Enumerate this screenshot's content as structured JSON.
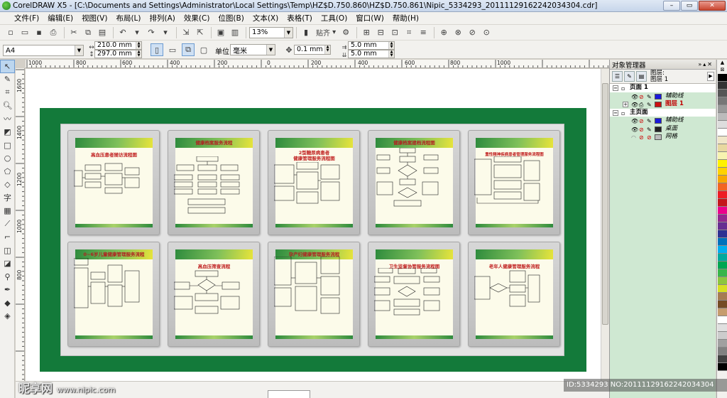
{
  "window": {
    "title": "CorelDRAW X5 - [C:\\Documents and Settings\\Administrator\\Local Settings\\Temp\\HZ$D.750.860\\HZ$D.750.861\\Nipic_5334293_20111129162242034304.cdr]",
    "min": "–",
    "max": "▭",
    "close": "✕"
  },
  "menu": [
    "文件(F)",
    "编辑(E)",
    "视图(V)",
    "布局(L)",
    "排列(A)",
    "效果(C)",
    "位图(B)",
    "文本(X)",
    "表格(T)",
    "工具(O)",
    "窗口(W)",
    "帮助(H)"
  ],
  "toolbar": {
    "zoom": "13%",
    "snap": "贴齐"
  },
  "property_bar": {
    "paper": "A4",
    "width": "210.0 mm",
    "height": "297.0 mm",
    "units_label": "单位:",
    "units": "毫米",
    "nudge": "0.1 mm",
    "dup_x": "5.0 mm",
    "dup_y": "5.0 mm"
  },
  "rulers": {
    "h": [
      "1000",
      "800",
      "600",
      "400",
      "200",
      "0",
      "200",
      "400",
      "600",
      "800",
      "1000"
    ],
    "v": [
      "1600",
      "1400",
      "1200",
      "1000",
      "800"
    ]
  },
  "panels": [
    {
      "title": "高血压患者随访流程图",
      "title_on_band": false
    },
    {
      "title": "健康档案服务流程",
      "title_on_band": true
    },
    {
      "title": "2型糖尿病患者\n健康管理服务流程图",
      "title_on_band": false
    },
    {
      "title": "健康档案建档流程图",
      "title_on_band": true
    },
    {
      "title": "重性精神疾病患者管理服务流程图",
      "title_on_band": false
    },
    {
      "title": "0~6岁儿童健康管理服务流程",
      "title_on_band": true
    },
    {
      "title": "高血压筛查流程",
      "title_on_band": false
    },
    {
      "title": "孕产妇健康管理服务流程",
      "title_on_band": true
    },
    {
      "title": "卫生监督协管服务流程图",
      "title_on_band": false
    },
    {
      "title": "老年人健康管理服务流程",
      "title_on_band": false
    }
  ],
  "docker": {
    "title": "对象管理器",
    "layer_header": "图层:",
    "layer_current": "图层 1",
    "tree": [
      {
        "type": "page",
        "label": "页面 1",
        "indent": 0
      },
      {
        "type": "layer",
        "label": "辅助线",
        "indent": 1,
        "color": "#1a1adc"
      },
      {
        "type": "layer1",
        "label": "图层 1",
        "indent": 1,
        "color": "#cc1111"
      },
      {
        "type": "page",
        "label": "主页面",
        "indent": 0
      },
      {
        "type": "layer",
        "label": "辅助线",
        "indent": 1,
        "color": "#1a1adc"
      },
      {
        "type": "layer",
        "label": "桌面",
        "indent": 1,
        "color": "#222222"
      },
      {
        "type": "layer",
        "label": "网格",
        "indent": 1,
        "color": "#bbbbbb"
      }
    ]
  },
  "palette": [
    "#000000",
    "#333333",
    "#555555",
    "#777777",
    "#999999",
    "#bbbbbb",
    "#dddddd",
    "#ffffff",
    "#f0e6c8",
    "#e8d8a0",
    "#f7f3b0",
    "#fff200",
    "#ffd200",
    "#f7a800",
    "#f26522",
    "#ed1c24",
    "#c4161c",
    "#ec008c",
    "#92278f",
    "#662d91",
    "#2e3192",
    "#0072bc",
    "#00aeef",
    "#00a99d",
    "#00a651",
    "#39b54a",
    "#8dc63f",
    "#d7df23",
    "#a67c52",
    "#754c24",
    "#c69c6d",
    "#ffffff",
    "#e0e0e0",
    "#cccccc",
    "#a0a0a0",
    "#808080",
    "#404040",
    "#000000"
  ],
  "watermark": {
    "left": "昵享网",
    "left_url": "www.nipic.com",
    "right": "ID:5334293 NO:20111129162242034304"
  }
}
